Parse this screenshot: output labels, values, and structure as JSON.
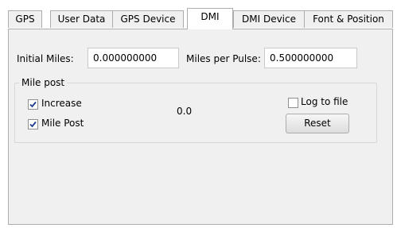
{
  "tabs": [
    {
      "label": "GPS",
      "active": false
    },
    {
      "label": "User Data",
      "active": false
    },
    {
      "label": "GPS Device",
      "active": false
    },
    {
      "label": "DMI",
      "active": true
    },
    {
      "label": "DMI Device",
      "active": false
    },
    {
      "label": "Font & Position",
      "active": false
    }
  ],
  "form": {
    "initial_miles_label": "Initial Miles:",
    "initial_miles_value": "0.000000000",
    "miles_per_pulse_label": "Miles per Pulse:",
    "miles_per_pulse_value": "0.500000000"
  },
  "mile_post": {
    "title": "Mile post",
    "increase_label": "Increase",
    "increase_checked": true,
    "mile_post_label": "Mile Post",
    "mile_post_checked": true,
    "current_value": "0.0",
    "log_to_file_label": "Log to file",
    "log_to_file_checked": false,
    "reset_label": "Reset"
  }
}
